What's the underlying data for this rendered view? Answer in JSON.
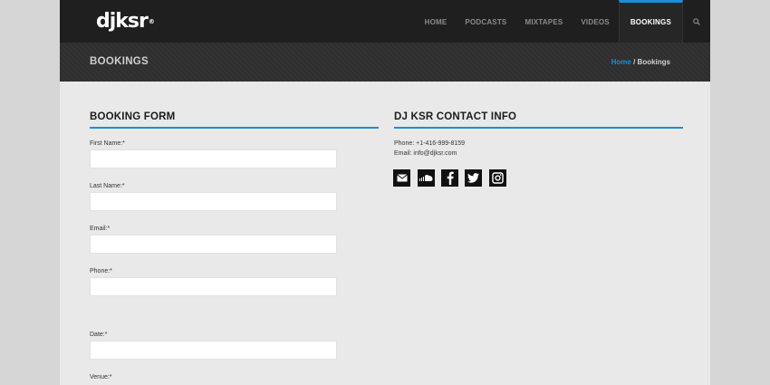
{
  "header": {
    "logo_text": "djksr",
    "logo_mark": "®",
    "nav": [
      {
        "label": "HOME"
      },
      {
        "label": "PODCASTS"
      },
      {
        "label": "MIXTAPES"
      },
      {
        "label": "VIDEOS"
      },
      {
        "label": "BOOKINGS",
        "active": true
      }
    ],
    "search_icon": "search-icon"
  },
  "titlebar": {
    "title": "BOOKINGS",
    "breadcrumb_home": "Home",
    "breadcrumb_sep": " / ",
    "breadcrumb_current": "Bookings"
  },
  "form": {
    "heading": "BOOKING FORM",
    "fields": [
      {
        "label": "First Name:*",
        "value": ""
      },
      {
        "label": "Last Name:*",
        "value": ""
      },
      {
        "label": "Email:*",
        "value": ""
      },
      {
        "label": "Phone:*",
        "value": ""
      },
      {
        "label": "Date:*",
        "value": ""
      },
      {
        "label": "Venue:*",
        "value": ""
      }
    ]
  },
  "contact": {
    "heading": "DJ KSR CONTACT INFO",
    "phone": "Phone: +1-416-999-8159",
    "email": "Email: info@djksr.com",
    "social": [
      "email-icon",
      "soundcloud-icon",
      "facebook-icon",
      "twitter-icon",
      "instagram-icon"
    ]
  },
  "colors": {
    "accent": "#1a8fd6",
    "topbar": "#1f1f1f",
    "titlebar": "#2f2f2f",
    "content_bg": "#e9e9e9",
    "outer_bg": "#d6d6d6"
  }
}
